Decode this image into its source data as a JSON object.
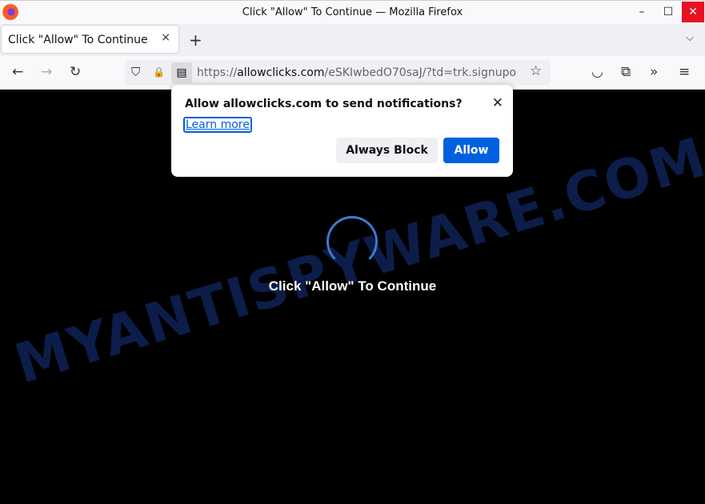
{
  "window": {
    "title": "Click \"Allow\" To Continue — Mozilla Firefox",
    "minimize": "–",
    "maximize": "☐",
    "close": "✕"
  },
  "tab": {
    "label": "Click \"Allow\" To Continue",
    "close": "×",
    "new_tab": "+",
    "list_all": "⌵"
  },
  "nav": {
    "back": "←",
    "forward": "→",
    "reload": "↻",
    "url_scheme": "https://",
    "url_host": "allowclicks.com",
    "url_path": "/eSKIwbedO70saJ/?td=trk.signupo",
    "bookmark": "☆",
    "pocket": "◡",
    "extensions": "⧉",
    "overflow": "»",
    "menu": "≡",
    "shield": "⛉",
    "lock": "🔒",
    "permission": "▤"
  },
  "page": {
    "message": "Click \"Allow\" To Continue",
    "watermark": "MYANTISPYWARE.COM",
    "spinner_color": "#3a7bd5"
  },
  "popup": {
    "title": "Allow allowclicks.com to send notifications?",
    "learn_more": "Learn more",
    "always_block": "Always Block",
    "allow": "Allow",
    "close": "✕"
  },
  "colors": {
    "accent": "#0061e0",
    "close_red": "#e81123"
  }
}
